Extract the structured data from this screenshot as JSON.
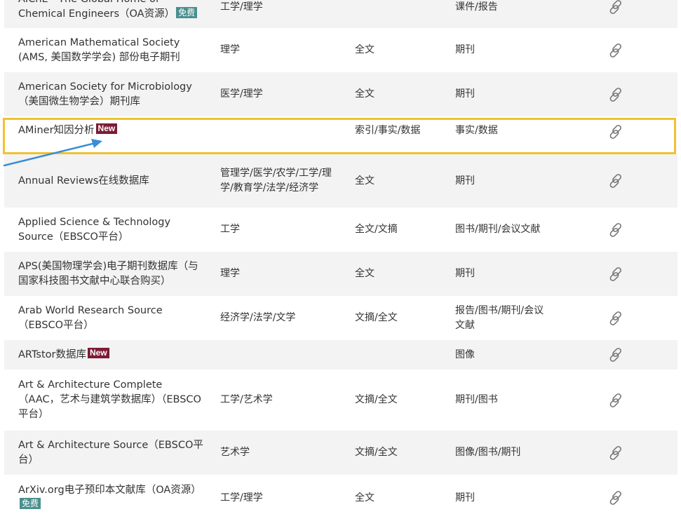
{
  "rows": [
    {
      "name": "AIChE - The Global Home of Chemical Engineers（OA资源）",
      "badge": "免费",
      "subject": "工学/理学",
      "content": "",
      "category": "课件/报告"
    },
    {
      "name": "American Mathematical Society (AMS, 美国数学学会) 部份电子期刊",
      "badge": "",
      "subject": "理学",
      "content": "全文",
      "category": "期刊"
    },
    {
      "name": "American Society for Microbiology（美国微生物学会）期刊库",
      "badge": "",
      "subject": "医学/理学",
      "content": "全文",
      "category": "期刊"
    },
    {
      "name": "AMiner知因分析",
      "badge": "New",
      "subject": "",
      "content": "索引/事实/数据",
      "category": "事实/数据"
    },
    {
      "name": "Annual Reviews在线数据库",
      "badge": "",
      "subject": "管理学/医学/农学/工学/理学/教育学/法学/经济学",
      "content": "全文",
      "category": "期刊"
    },
    {
      "name": "Applied Science & Technology Source（EBSCO平台）",
      "badge": "",
      "subject": "工学",
      "content": "全文/文摘",
      "category": "图书/期刊/会议文献"
    },
    {
      "name": "APS(美国物理学会)电子期刊数据库（与国家科技图书文献中心联合购买）",
      "badge": "",
      "subject": "理学",
      "content": "全文",
      "category": "期刊"
    },
    {
      "name": "Arab World Research Source（EBSCO平台）",
      "badge": "",
      "subject": "经济学/法学/文学",
      "content": "文摘/全文",
      "category": "报告/图书/期刊/会议文献"
    },
    {
      "name": "ARTstor数据库",
      "badge": "New",
      "subject": "",
      "content": "",
      "category": "图像"
    },
    {
      "name": "Art & Architecture Complete （AAC，艺术与建筑学数据库）（EBSCO平台）",
      "badge": "",
      "subject": "工学/艺术学",
      "content": "文摘/全文",
      "category": "期刊/图书"
    },
    {
      "name": "Art & Architecture Source（EBSCO平台）",
      "badge": "",
      "subject": "艺术学",
      "content": "文摘/全文",
      "category": "图像/图书/期刊"
    },
    {
      "name": "ArXiv.org电子预印本文献库（OA资源）",
      "badge": "免费",
      "subject": "工学/理学",
      "content": "全文",
      "category": "期刊"
    }
  ],
  "icons": {
    "link": "link-icon",
    "annotation": "arrow-annotation"
  },
  "colors": {
    "highlight": "#f0c230",
    "new_badge": "#7d1b35",
    "free_badge": "#4b8f8f",
    "row_gray": "#f3f3f3"
  }
}
